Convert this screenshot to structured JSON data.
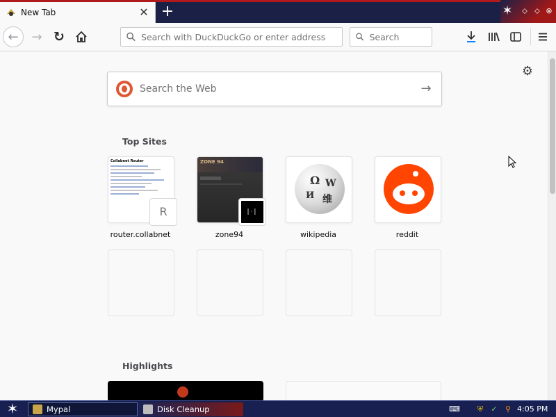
{
  "browser": {
    "tab": {
      "title": "New Tab",
      "close": "✕"
    },
    "new_tab": "+",
    "nav": {
      "back": "←",
      "forward": "→",
      "reload": "↻",
      "home": "⌂",
      "url_placeholder": "Search with DuckDuckGo or enter address",
      "search_placeholder": "Search"
    },
    "window_controls": [
      "⬦",
      "⬦",
      "⊗"
    ]
  },
  "newtab": {
    "web_search_placeholder": "Search the Web",
    "top_sites_title": "Top Sites",
    "top_sites": [
      {
        "label": "router.collabnet",
        "badge": "R",
        "thumb_title": "Collabnet Router"
      },
      {
        "label": "zone94",
        "badge": "|·|",
        "thumb_title": "ZONE 94"
      },
      {
        "label": "wikipedia"
      },
      {
        "label": "reddit"
      }
    ],
    "highlights_title": "Highlights"
  },
  "taskbar": {
    "items": [
      {
        "label": "Mypal"
      },
      {
        "label": "Disk Cleanup"
      }
    ],
    "clock": "4:05 PM"
  },
  "colors": {
    "tabstrip": "#1b2047",
    "ddg": "#de5833",
    "reddit": "#ff4500",
    "taskbar": "#172050"
  }
}
